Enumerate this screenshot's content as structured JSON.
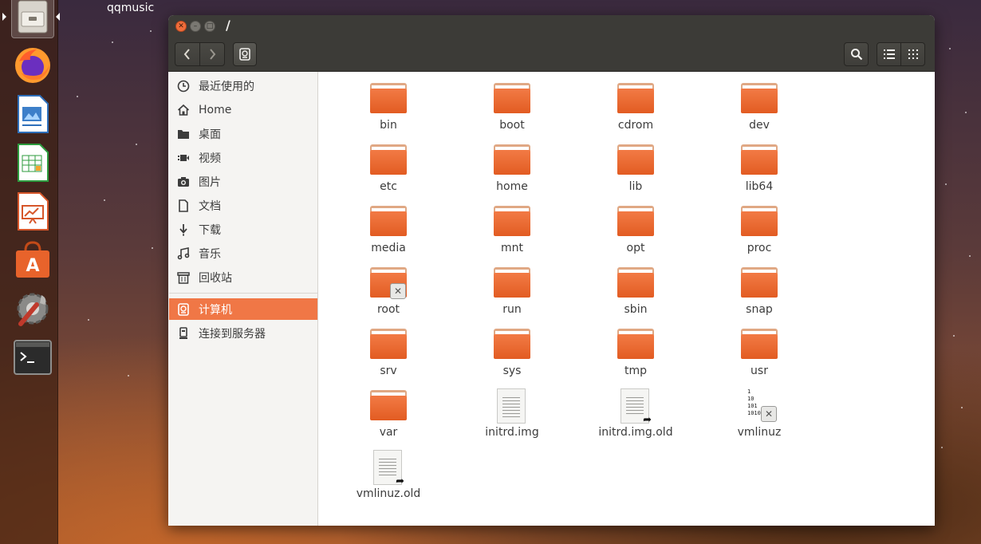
{
  "desktop": {
    "app_title": "qqmusic"
  },
  "launcher": {
    "items": [
      {
        "name": "Files",
        "icon": "file-cabinet-icon",
        "active": true
      },
      {
        "name": "Firefox",
        "icon": "firefox-icon"
      },
      {
        "name": "LibreOffice Writer",
        "icon": "writer-icon"
      },
      {
        "name": "LibreOffice Calc",
        "icon": "calc-icon"
      },
      {
        "name": "LibreOffice Impress",
        "icon": "impress-icon"
      },
      {
        "name": "Ubuntu Software",
        "icon": "software-center-icon"
      },
      {
        "name": "System Settings",
        "icon": "settings-icon"
      },
      {
        "name": "Terminal",
        "icon": "terminal-icon"
      }
    ]
  },
  "window": {
    "path_title": "/"
  },
  "sidebar": {
    "items": [
      {
        "label": "最近使用的",
        "icon": "clock-icon"
      },
      {
        "label": "Home",
        "icon": "home-icon"
      },
      {
        "label": "桌面",
        "icon": "desktop-folder-icon"
      },
      {
        "label": "视频",
        "icon": "video-icon"
      },
      {
        "label": "图片",
        "icon": "camera-icon"
      },
      {
        "label": "文档",
        "icon": "document-icon"
      },
      {
        "label": "下载",
        "icon": "download-icon"
      },
      {
        "label": "音乐",
        "icon": "music-icon"
      },
      {
        "label": "回收站",
        "icon": "trash-icon"
      },
      {
        "label": "计算机",
        "icon": "computer-icon",
        "selected": true
      },
      {
        "label": "连接到服务器",
        "icon": "server-icon"
      }
    ]
  },
  "files": [
    {
      "name": "bin",
      "type": "folder"
    },
    {
      "name": "boot",
      "type": "folder"
    },
    {
      "name": "cdrom",
      "type": "folder"
    },
    {
      "name": "dev",
      "type": "folder"
    },
    {
      "name": "etc",
      "type": "folder"
    },
    {
      "name": "home",
      "type": "folder"
    },
    {
      "name": "lib",
      "type": "folder"
    },
    {
      "name": "lib64",
      "type": "folder"
    },
    {
      "name": "media",
      "type": "folder"
    },
    {
      "name": "mnt",
      "type": "folder"
    },
    {
      "name": "opt",
      "type": "folder"
    },
    {
      "name": "proc",
      "type": "folder"
    },
    {
      "name": "root",
      "type": "folder-locked"
    },
    {
      "name": "run",
      "type": "folder"
    },
    {
      "name": "sbin",
      "type": "folder"
    },
    {
      "name": "snap",
      "type": "folder"
    },
    {
      "name": "srv",
      "type": "folder"
    },
    {
      "name": "sys",
      "type": "folder"
    },
    {
      "name": "tmp",
      "type": "folder"
    },
    {
      "name": "usr",
      "type": "folder"
    },
    {
      "name": "var",
      "type": "folder"
    },
    {
      "name": "initrd.img",
      "type": "document-link"
    },
    {
      "name": "initrd.img.old",
      "type": "document-link"
    },
    {
      "name": "vmlinuz",
      "type": "binary-link-locked"
    },
    {
      "name": "vmlinuz.old",
      "type": "document-link"
    }
  ],
  "colors": {
    "accent": "#f07746",
    "titlebar": "#3c3b37",
    "folder": "#e9682f"
  }
}
